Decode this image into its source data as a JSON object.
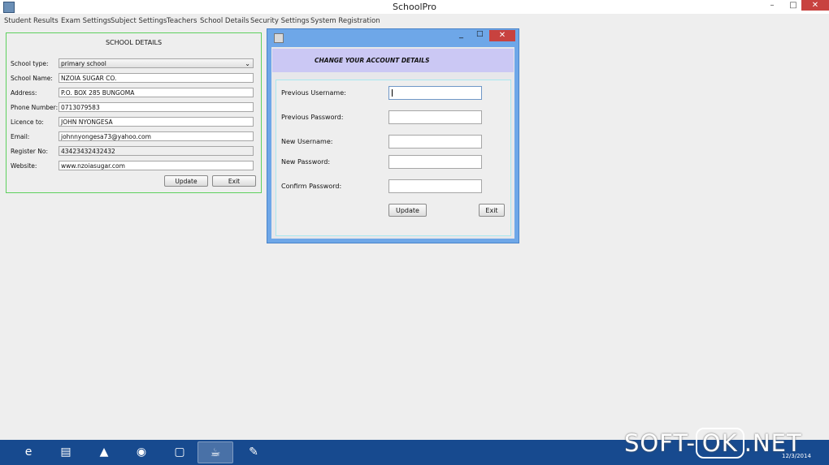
{
  "window": {
    "title": "SchoolPro",
    "minimize": "–",
    "maximize": "□",
    "close": "✕"
  },
  "menu": [
    "Student",
    "Results",
    "Exam Settings",
    "Subject Settings",
    "Teachers",
    "School Details",
    "Security Settings",
    "System Registration"
  ],
  "school_details": {
    "heading": "SCHOOL DETAILS",
    "fields": [
      {
        "label": "School type:",
        "value": "primary school"
      },
      {
        "label": "School Name:",
        "value": "NZOIA SUGAR CO."
      },
      {
        "label": "Address:",
        "value": "P.O. BOX 285 BUNGOMA"
      },
      {
        "label": "Phone Number:",
        "value": "0713079583"
      },
      {
        "label": "Licence to:",
        "value": "JOHN NYONGESA"
      },
      {
        "label": "Email:",
        "value": "johnnyongesa73@yahoo.com"
      },
      {
        "label": "Register No:",
        "value": "43423432432432"
      },
      {
        "label": "Website:",
        "value": "www.nzoiasugar.com"
      }
    ],
    "update_label": "Update",
    "exit_label": "Exit"
  },
  "dialog": {
    "header": "CHANGE YOUR ACCOUNT DETAILS",
    "minimize": "_",
    "maximize": "□",
    "close": "✕",
    "fields": [
      {
        "label": "Previous Username:",
        "value": ""
      },
      {
        "label": "Previous Password:",
        "value": ""
      },
      {
        "label": "New Username:",
        "value": ""
      },
      {
        "label": "New Password:",
        "value": ""
      },
      {
        "label": "Confirm Password:",
        "value": ""
      }
    ],
    "update_label": "Update",
    "exit_label": "Exit"
  },
  "taskbar": {
    "apps": [
      "internet-explorer-icon",
      "file-explorer-icon",
      "vlc-icon",
      "chrome-icon",
      "virtualbox-icon",
      "java-icon",
      "paint-icon"
    ],
    "date": "12/3/2014"
  },
  "watermark": {
    "left": "SOFT-",
    "ok": "OK",
    "right": ".NET"
  },
  "colors": {
    "titlebar_close": "#c8423f",
    "dialog_frame": "#6ea7e8",
    "dialog_header": "#cbc8f4",
    "taskbar": "#174a8f",
    "panel_border": "#5ed05e"
  }
}
